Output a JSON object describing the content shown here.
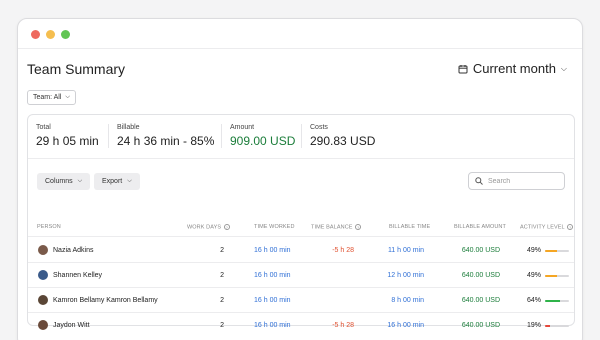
{
  "window": {
    "controls": [
      "close",
      "minimize",
      "maximize"
    ]
  },
  "header": {
    "title": "Team Summary",
    "period_label": "Current month",
    "period_icon": "calendar-icon"
  },
  "filters": {
    "team_label": "Team: All"
  },
  "stats": [
    {
      "label": "Total",
      "value": "29 h 05 min"
    },
    {
      "label": "Billable",
      "value": "24 h 36 min - 85%"
    },
    {
      "label": "Amount",
      "value": "909.00 USD"
    },
    {
      "label": "Costs",
      "value": "290.83 USD"
    }
  ],
  "toolbar": {
    "columns_label": "Columns",
    "export_label": "Export",
    "search_placeholder": "Search"
  },
  "table": {
    "columns": [
      "PERSON",
      "WORK DAYS",
      "TIME WORKED",
      "TIME BALANCE",
      "BILLABLE TIME",
      "BILLABLE AMOUNT",
      "ACTIVITY LEVEL"
    ],
    "rows": [
      {
        "name": "Nazia Adkins",
        "work_days": "2",
        "time_worked": "16 h 00 min",
        "time_balance": "-5 h 28",
        "billable_time": "11 h 00 min",
        "billable_amount": "640.00 USD",
        "activity": "49%",
        "activity_level": 0.49,
        "bar_color": "#f5a623"
      },
      {
        "name": "Shannen Kelley",
        "work_days": "2",
        "time_worked": "16 h 00 min",
        "time_balance": "",
        "billable_time": "12 h 00 min",
        "billable_amount": "640.00 USD",
        "activity": "49%",
        "activity_level": 0.49,
        "bar_color": "#f5a623"
      },
      {
        "name": "Kamron Bellamy Kamron Bellamy",
        "work_days": "2",
        "time_worked": "16 h 00 min",
        "time_balance": "",
        "billable_time": "8 h 00 min",
        "billable_amount": "640.00 USD",
        "activity": "64%",
        "activity_level": 0.64,
        "bar_color": "#2fb34a"
      },
      {
        "name": "Jaydon Witt",
        "work_days": "2",
        "time_worked": "16 h 00 min",
        "time_balance": "-5 h 28",
        "billable_time": "16 h 00 min",
        "billable_amount": "640.00 USD",
        "activity": "19%",
        "activity_level": 0.19,
        "bar_color": "#e5483b"
      }
    ]
  },
  "colors": {
    "link_blue": "#2f6fd6",
    "amount_green": "#1b7d3a",
    "negative_red": "#e0502f"
  }
}
